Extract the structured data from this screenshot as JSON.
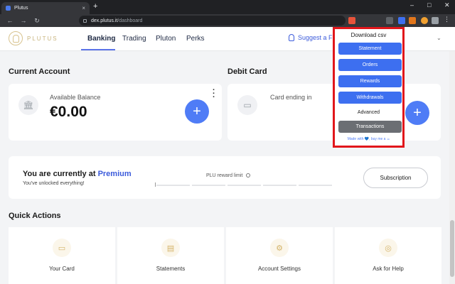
{
  "browser": {
    "tab_title": "Plutus",
    "url_host": "dex.plutus.it",
    "url_path": "/dashboard",
    "new_tab": "+",
    "tab_close": "×",
    "win_min": "–",
    "win_max": "□",
    "win_close": "✕"
  },
  "site": {
    "logo_text": "PLUTUS",
    "nav": [
      "Banking",
      "Trading",
      "Pluton",
      "Perks"
    ],
    "suggest": "Suggest a F"
  },
  "current_account": {
    "heading": "Current Account",
    "balance_label": "Available Balance",
    "balance_value": "€0.00"
  },
  "debit_card": {
    "heading": "Debit Card",
    "card_label": "Card ending in"
  },
  "premium": {
    "title_prefix": "You are currently at ",
    "title_highlight": "Premium",
    "subtitle": "You've unlocked everything!",
    "reward_limit_label": "PLU reward limit",
    "subscription_button": "Subscription"
  },
  "quick_actions": {
    "heading": "Quick Actions",
    "items": [
      "Your Card",
      "Statements",
      "Account Settings",
      "Ask for Help"
    ]
  },
  "popup": {
    "title": "Download csv",
    "buttons": [
      "Statement",
      "Orders",
      "Rewards",
      "Withdrawals"
    ],
    "advanced_label": "Advanced",
    "advanced_button": "Transactions",
    "made_with": "Made with 💙, buy me a ☕"
  },
  "colors": {
    "accent": "#4f7cf6",
    "highlight_border": "#e1161b",
    "gold": "#d4b46a"
  }
}
